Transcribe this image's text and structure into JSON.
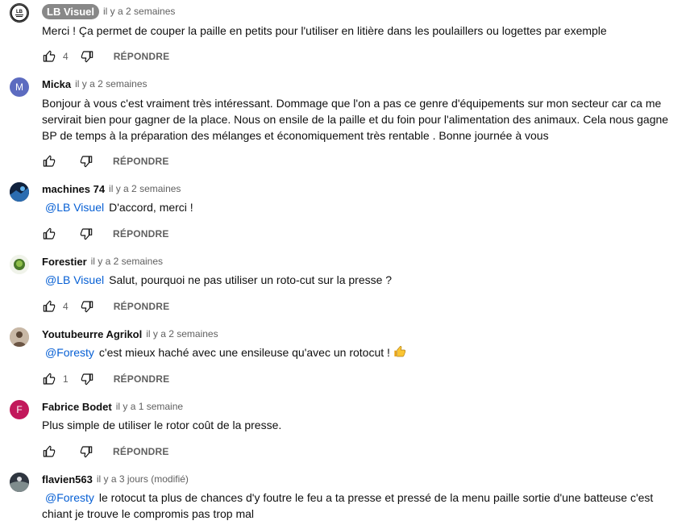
{
  "labels": {
    "reply": "RÉPONDRE"
  },
  "colors": {
    "mention": "#065fd4",
    "secondary_text": "#606060"
  },
  "comments": [
    {
      "author": "LB Visuel",
      "author_is_owner": true,
      "avatar_text": "LB",
      "time": "il y a 2 semaines",
      "text": "Merci ! Ça permet de couper la paille en petits pour l'utiliser en litière dans les poulaillers ou logettes par exemple",
      "likes": "4"
    },
    {
      "author": "Micka",
      "avatar_letter": "M",
      "avatar_color": "#5c6bc0",
      "time": "il y a 2 semaines",
      "text_lines": [
        "Bonjour à vous c'est vraiment très intéressant. Dommage que l'on a pas ce genre d'équipements sur mon secteur car ca me",
        "servirait bien pour gagner de la place. Nous on ensile de la paille et du foin pour l'alimentation des animaux. Cela nous gagne",
        "BP de temps à la préparation des mélanges et économiquement très rentable . Bonne journée à vous"
      ],
      "likes": ""
    },
    {
      "author": "machines 74",
      "time": "il y a 2 semaines",
      "mention": "@LB Visuel",
      "text": "D'accord, merci !",
      "likes": ""
    },
    {
      "author": "Forestier",
      "time": "il y a 2 semaines",
      "mention": "@LB Visuel",
      "text": "Salut, pourquoi ne pas utiliser un roto-cut sur la presse ?",
      "likes": "4"
    },
    {
      "author": "Youtubeurre Agrikol",
      "time": "il y a 2 semaines",
      "mention": "@Foresty",
      "text": "c'est mieux haché avec une ensileuse qu'avec un rotocut !",
      "emoji": "thumbs-up-emoji",
      "likes": "1"
    },
    {
      "author": "Fabrice Bodet",
      "avatar_letter": "F",
      "avatar_color": "#c2185b",
      "time": "il y a 1 semaine",
      "text": "Plus simple de utiliser le rotor coût de la presse.",
      "likes": ""
    },
    {
      "author": "flavien563",
      "time": "il y a 3 jours (modifié)",
      "mention": "@Foresty",
      "text_lines": [
        "le rotocut ta plus de chances d'y foutre le feu a ta presse et pressé de la menu paille sortie d'une batteuse c'est",
        "chiant je trouve le compromis pas trop mal"
      ]
    }
  ]
}
